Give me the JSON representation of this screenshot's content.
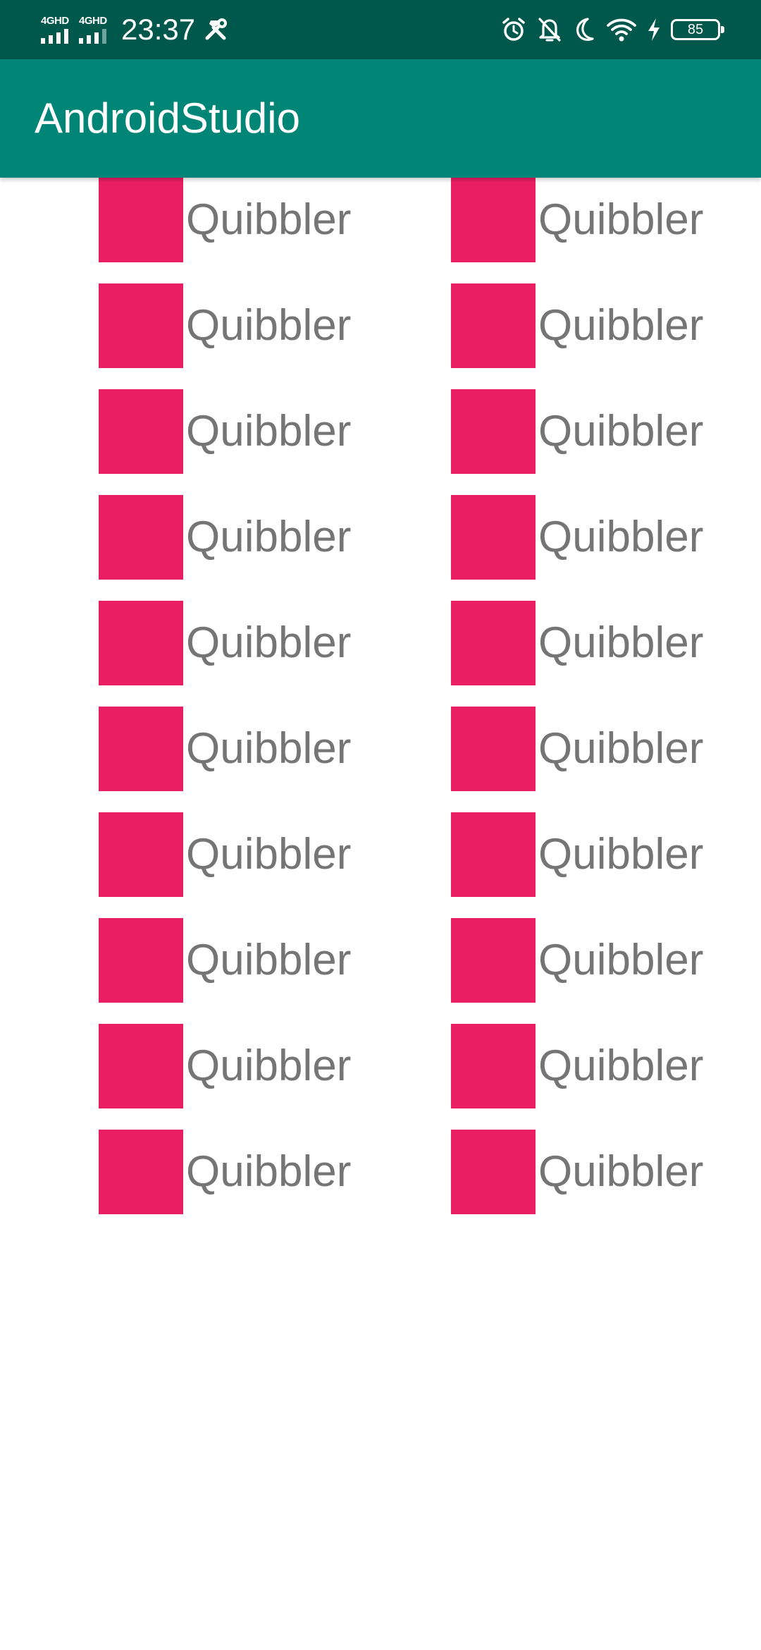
{
  "status_bar": {
    "signal_1_label": "4GHD",
    "signal_2_label": "4GHD",
    "time": "23:37",
    "battery_level": "85",
    "icons": [
      "signal-icon",
      "signal-icon",
      "build-tools-icon",
      "alarm-icon",
      "bell-off-icon",
      "moon-icon",
      "wifi-icon",
      "charging-bolt-icon",
      "battery-icon"
    ]
  },
  "app_bar": {
    "title": "AndroidStudio",
    "color": "#008577",
    "status_color": "#00574b"
  },
  "grid": {
    "swatch_color": "#e91e63",
    "text_color": "#757575",
    "items": [
      {
        "label": "Quibbler"
      },
      {
        "label": "Quibbler"
      },
      {
        "label": "Quibbler"
      },
      {
        "label": "Quibbler"
      },
      {
        "label": "Quibbler"
      },
      {
        "label": "Quibbler"
      },
      {
        "label": "Quibbler"
      },
      {
        "label": "Quibbler"
      },
      {
        "label": "Quibbler"
      },
      {
        "label": "Quibbler"
      },
      {
        "label": "Quibbler"
      },
      {
        "label": "Quibbler"
      },
      {
        "label": "Quibbler"
      },
      {
        "label": "Quibbler"
      },
      {
        "label": "Quibbler"
      },
      {
        "label": "Quibbler"
      },
      {
        "label": "Quibbler"
      },
      {
        "label": "Quibbler"
      },
      {
        "label": "Quibbler"
      },
      {
        "label": "Quibbler"
      }
    ]
  }
}
